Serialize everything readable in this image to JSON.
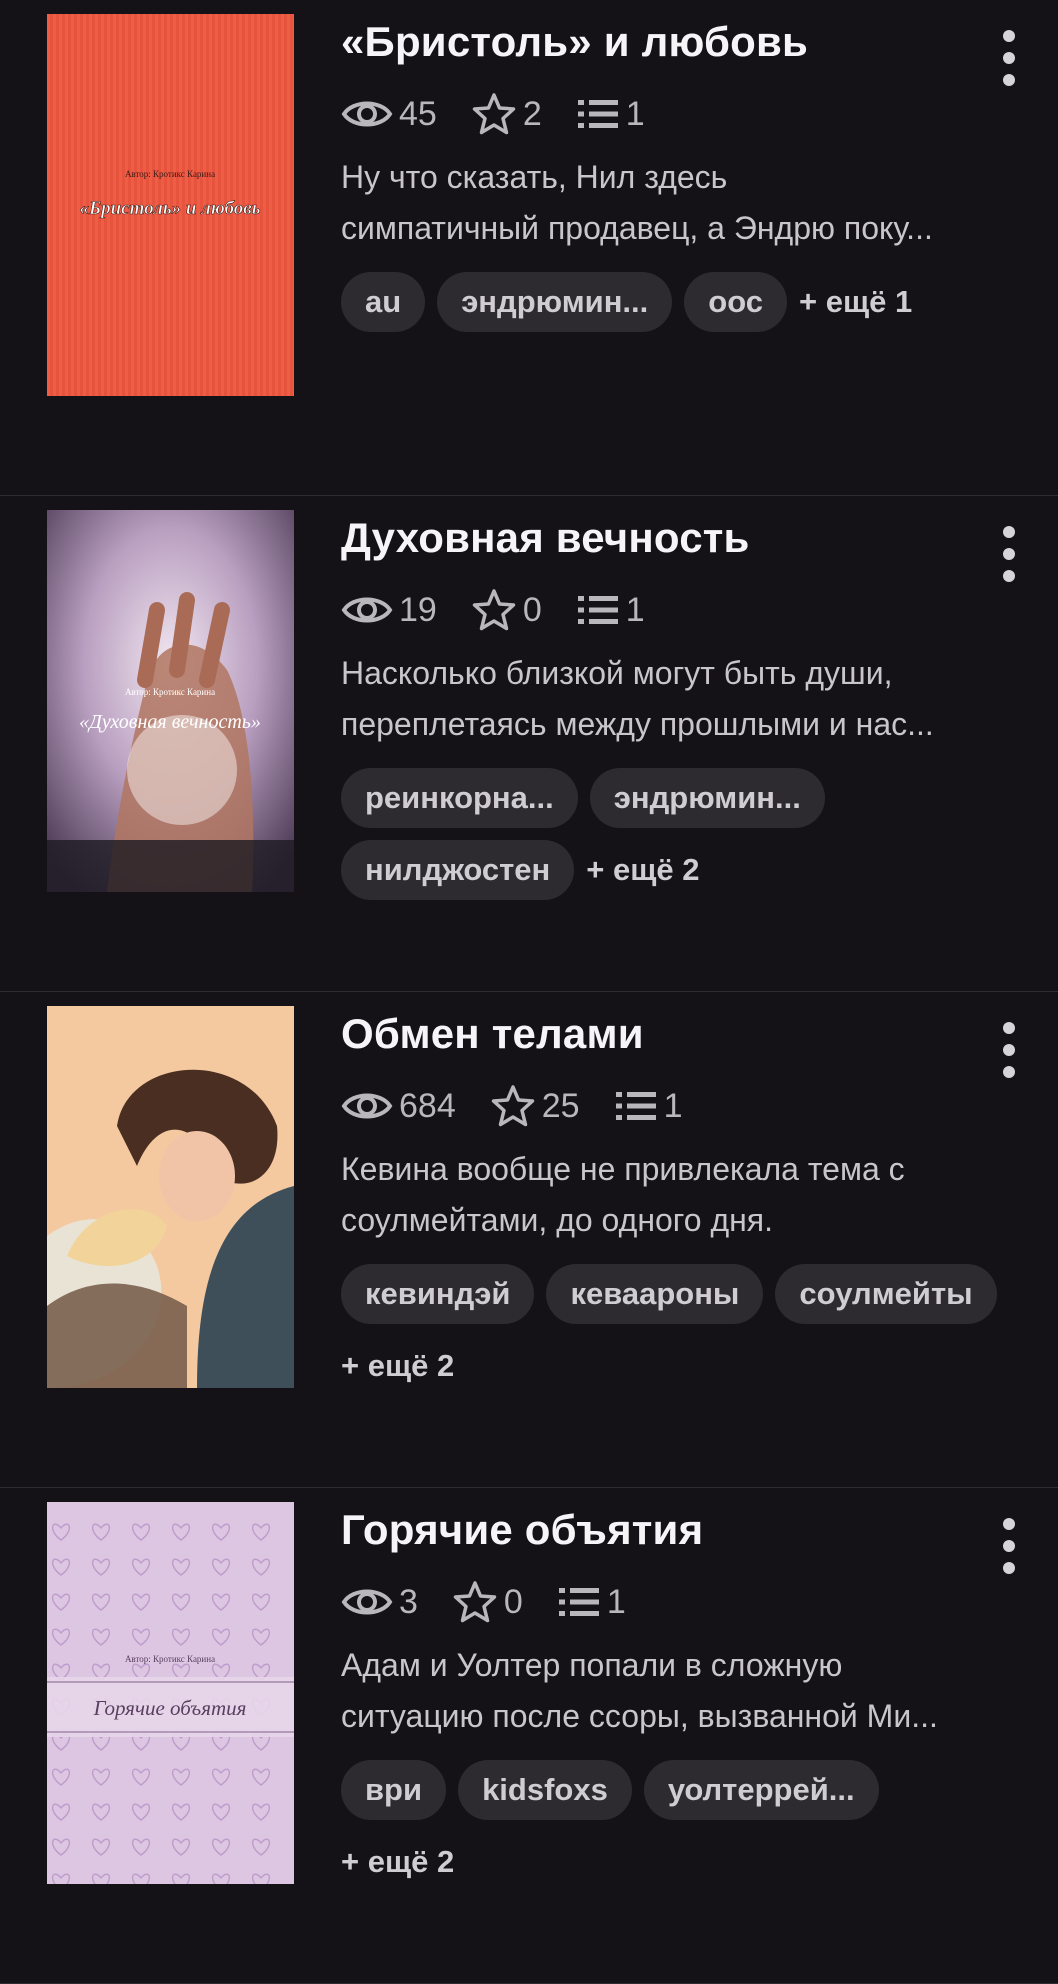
{
  "stories": [
    {
      "title": "«Бристоль» и любовь",
      "views": "45",
      "likes": "2",
      "parts": "1",
      "description": [
        "Ну что сказать, Нил здесь",
        "симпатичный продавец, а Эндрю поку..."
      ],
      "tags": [
        "au",
        "эндрюмин...",
        "оос"
      ],
      "more": "+ ещё 1",
      "cover": {
        "author_line": "Автор: Кротикс Карина",
        "title_line": "«Бристоль» и любовь",
        "colors": [
          "#e8533e",
          "#f06b4d"
        ]
      }
    },
    {
      "title": "Духовная вечность",
      "views": "19",
      "likes": "0",
      "parts": "1",
      "description": [
        "Насколько близкой могут быть души,",
        "переплетаясь между прошлыми и нас..."
      ],
      "tags": [
        "реинкорна...",
        "эндрюмин...",
        "нилджостен"
      ],
      "more": "+ ещё 2",
      "cover": {
        "author_line": "Автор: Кротикс Карина",
        "title_line": "«Духовная вечность»",
        "colors": [
          "#cdbdd4",
          "#8a6f8f"
        ]
      }
    },
    {
      "title": "Обмен телами",
      "views": "684",
      "likes": "25",
      "parts": "1",
      "description": [
        "Кевина вообще не привлекала тема с",
        "соулмейтами, до одного дня."
      ],
      "tags": [
        "кевиндэй",
        "кеваароны",
        "соулмейты"
      ],
      "more": "+ ещё 2",
      "cover": {
        "colors": [
          "#f4c9a0",
          "#3e4f5a"
        ]
      }
    },
    {
      "title": "Горячие объятия",
      "views": "3",
      "likes": "0",
      "parts": "1",
      "description": [
        "Адам и Уолтер попали в сложную",
        "ситуацию после ссоры, вызванной Ми..."
      ],
      "tags": [
        "ври",
        "kidsfoxs",
        "уолтеррей..."
      ],
      "more": "+ ещё 2",
      "cover": {
        "author_line": "Автор: Кротикс Карина",
        "title_line": "Горячие объятия",
        "colors": [
          "#dcc6e2",
          "#c9a9d3"
        ]
      }
    }
  ],
  "icons": {
    "views": "eye-icon",
    "likes": "star-icon",
    "parts": "list-icon",
    "menu": "more-vertical-icon"
  }
}
